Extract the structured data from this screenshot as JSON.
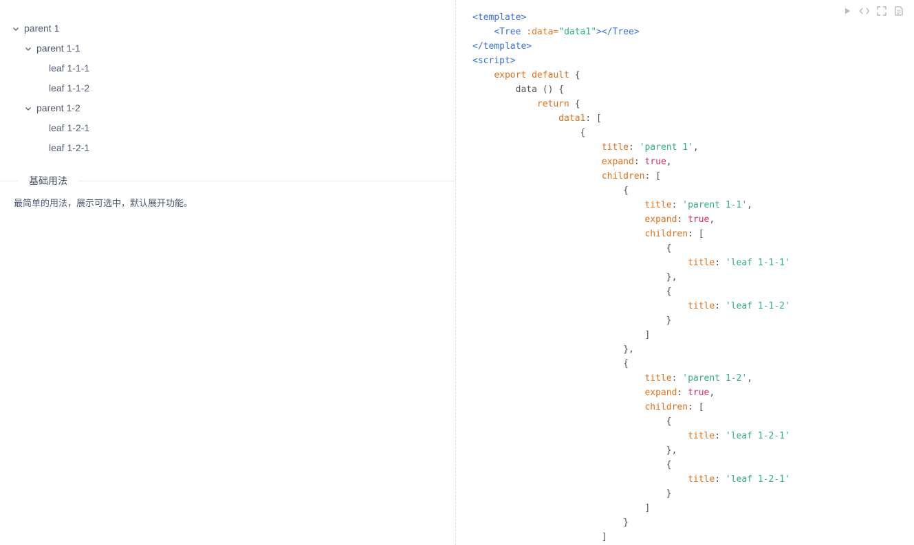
{
  "tree": {
    "parent1": "parent 1",
    "parent1_1": "parent 1-1",
    "leaf1_1_1": "leaf 1-1-1",
    "leaf1_1_2": "leaf 1-1-2",
    "parent1_2": "parent 1-2",
    "leaf1_2_1a": "leaf 1-2-1",
    "leaf1_2_1b": "leaf 1-2-1"
  },
  "meta": {
    "title": "基础用法",
    "description": "最简单的用法，展示可选中，默认展开功能。"
  },
  "toolbar": {
    "icons": [
      "play-icon",
      "code-icon",
      "fullscreen-icon",
      "copy-icon"
    ]
  },
  "code": {
    "t_open": "<template>",
    "tree_open": "<Tree",
    "attr_data": " :data=",
    "attr_val": "\"data1\"",
    "tree_gt": ">",
    "tree_close": "</Tree>",
    "t_close": "</template>",
    "script_open": "<script>",
    "export_default": "export default",
    "brace_open": " {",
    "data_fn": "data () {",
    "return_kw": "return",
    "data1_key": "data1",
    "colon_bracket": ": [",
    "lbrace": "{",
    "title_key": "title",
    "colon": ": ",
    "parent1_str": "'parent 1'",
    "comma": ",",
    "expand_key": "expand",
    "true_val": "true",
    "children_key": "children",
    "parent1_1_str": "'parent 1-1'",
    "leaf1_1_1_str": "'leaf 1-1-1'",
    "rbrace_comma": "},",
    "leaf1_1_2_str": "'leaf 1-1-2'",
    "rbrace": "}",
    "rbracket": "]",
    "parent1_2_str": "'parent 1-2'",
    "leaf1_2_1_str": "'leaf 1-2-1'"
  }
}
